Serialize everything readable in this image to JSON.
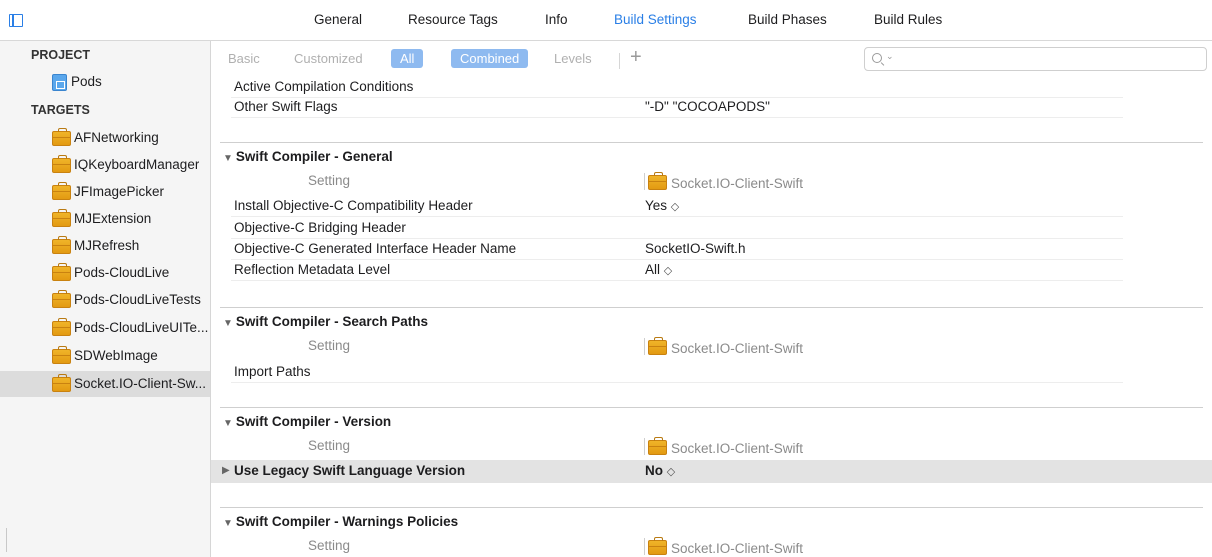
{
  "tabs": [
    {
      "label": "General"
    },
    {
      "label": "Resource Tags"
    },
    {
      "label": "Info"
    },
    {
      "label": "Build Settings",
      "active": true
    },
    {
      "label": "Build Phases"
    },
    {
      "label": "Build Rules"
    }
  ],
  "sidebar": {
    "project_heading": "PROJECT",
    "project_item": "Pods",
    "targets_heading": "TARGETS",
    "targets": [
      "AFNetworking",
      "IQKeyboardManager",
      "JFImagePicker",
      "MJExtension",
      "MJRefresh",
      "Pods-CloudLive",
      "Pods-CloudLiveTests",
      "Pods-CloudLiveUITe...",
      "SDWebImage",
      "Socket.IO-Client-Sw..."
    ],
    "selected_target": "Socket.IO-Client-Sw..."
  },
  "filters": {
    "basic": "Basic",
    "customized": "Customized",
    "all": "All",
    "combined": "Combined",
    "levels": "Levels",
    "add": "+"
  },
  "search": {
    "value": "",
    "placeholder": ""
  },
  "content": {
    "top_rows": [
      {
        "name": "Active Compilation Conditions",
        "value": ""
      },
      {
        "name": "Other Swift Flags",
        "value": "\"-D\" \"COCOAPODS\""
      }
    ],
    "setting_label": "Setting",
    "target_label": "Socket.IO-Client-Swift",
    "sections": [
      {
        "title": "Swift Compiler - General",
        "rows": [
          {
            "name": "Install Objective-C Compatibility Header",
            "value": "Yes",
            "stepper": "◇"
          },
          {
            "name": "Objective-C Bridging Header",
            "value": ""
          },
          {
            "name": "Objective-C Generated Interface Header Name",
            "value": "SocketIO-Swift.h"
          },
          {
            "name": "Reflection Metadata Level",
            "value": "All",
            "stepper": "◇"
          }
        ]
      },
      {
        "title": "Swift Compiler - Search Paths",
        "rows": [
          {
            "name": "Import Paths",
            "value": ""
          }
        ]
      },
      {
        "title": "Swift Compiler - Version",
        "rows": [
          {
            "name": "Use Legacy Swift Language Version",
            "value": "No",
            "stepper": "◇",
            "highlight": true
          }
        ]
      },
      {
        "title": "Swift Compiler - Warnings Policies",
        "rows": []
      }
    ]
  },
  "colors": {
    "accent": "#2a7fe6",
    "pill": "#8ebaf0",
    "briefcase": "#f0b429"
  }
}
